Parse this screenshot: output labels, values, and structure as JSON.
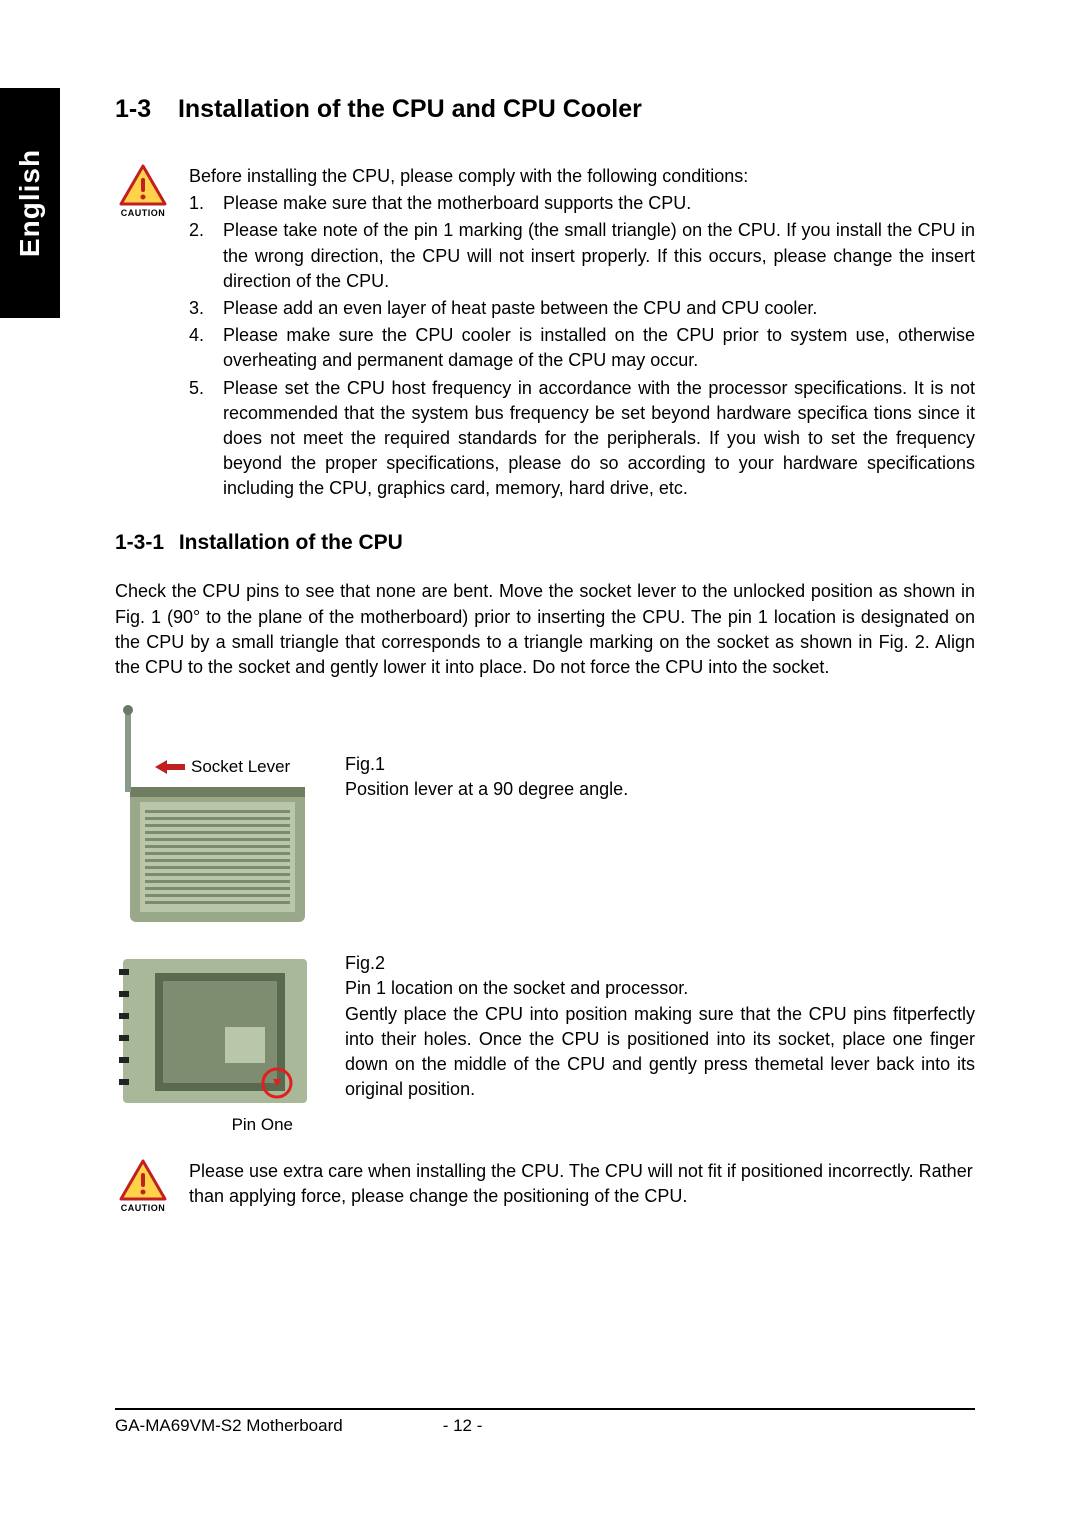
{
  "sideTab": "English",
  "section": {
    "number": "1-3",
    "title": "Installation of the CPU and CPU Cooler"
  },
  "cautionLabel": "CAUTION",
  "intro": "Before installing the CPU, please comply with the following conditions:",
  "conditions": [
    "Please make sure that the motherboard supports the CPU.",
    "Please take note of the pin 1 marking (the small triangle) on the CPU.  If you install the CPU in the wrong direction, the CPU will not insert properly.  If this occurs, please change the insert direction of the CPU.",
    "Please add an even layer of heat paste between the CPU and CPU cooler.",
    "Please make sure the CPU cooler is installed on the CPU prior to system use, otherwise overheating and permanent damage of the CPU may occur.",
    "Please set the CPU host frequency in accordance with the processor specifications. It is not recommended that the system bus frequency be set beyond hardware specifica tions since it does not meet the required standards for the peripherals.  If you wish to set the frequency beyond the proper specifications, please do so according to your hardware specifications including the CPU, graphics card, memory, hard drive, etc."
  ],
  "subsection": {
    "number": "1-3-1",
    "title": "Installation of the CPU"
  },
  "bodyPara": "Check the CPU pins to see that none are bent. Move the socket lever to the unlocked position as shown in Fig. 1 (90° to the plane of the motherboard) prior to inserting the CPU. The pin 1 location is designated on the CPU by a small triangle that corresponds to a triangle marking on the socket as shown in Fig. 2. Align the CPU to the socket and gently lower it into place. Do not force the CPU into the socket.",
  "fig1": {
    "arrowLabel": "Socket Lever",
    "title": "Fig.1",
    "caption": "Position lever at a 90 degree angle."
  },
  "fig2": {
    "pinOneLabel": "Pin One",
    "title": "Fig.2",
    "line1": "Pin 1 location on the socket and processor.",
    "line2": "Gently place the CPU into position making sure that the CPU pins fitperfectly into their holes. Once the CPU is positioned into its socket, place one finger down on the middle of the CPU and gently press themetal lever back into its original position."
  },
  "caution2": "Please use extra care when installing the CPU. The CPU will not fit if positioned incorrectly. Rather than applying force, please change the positioning of the CPU.",
  "footer": {
    "product": "GA-MA69VM-S2 Motherboard",
    "page": "- 12 -"
  }
}
